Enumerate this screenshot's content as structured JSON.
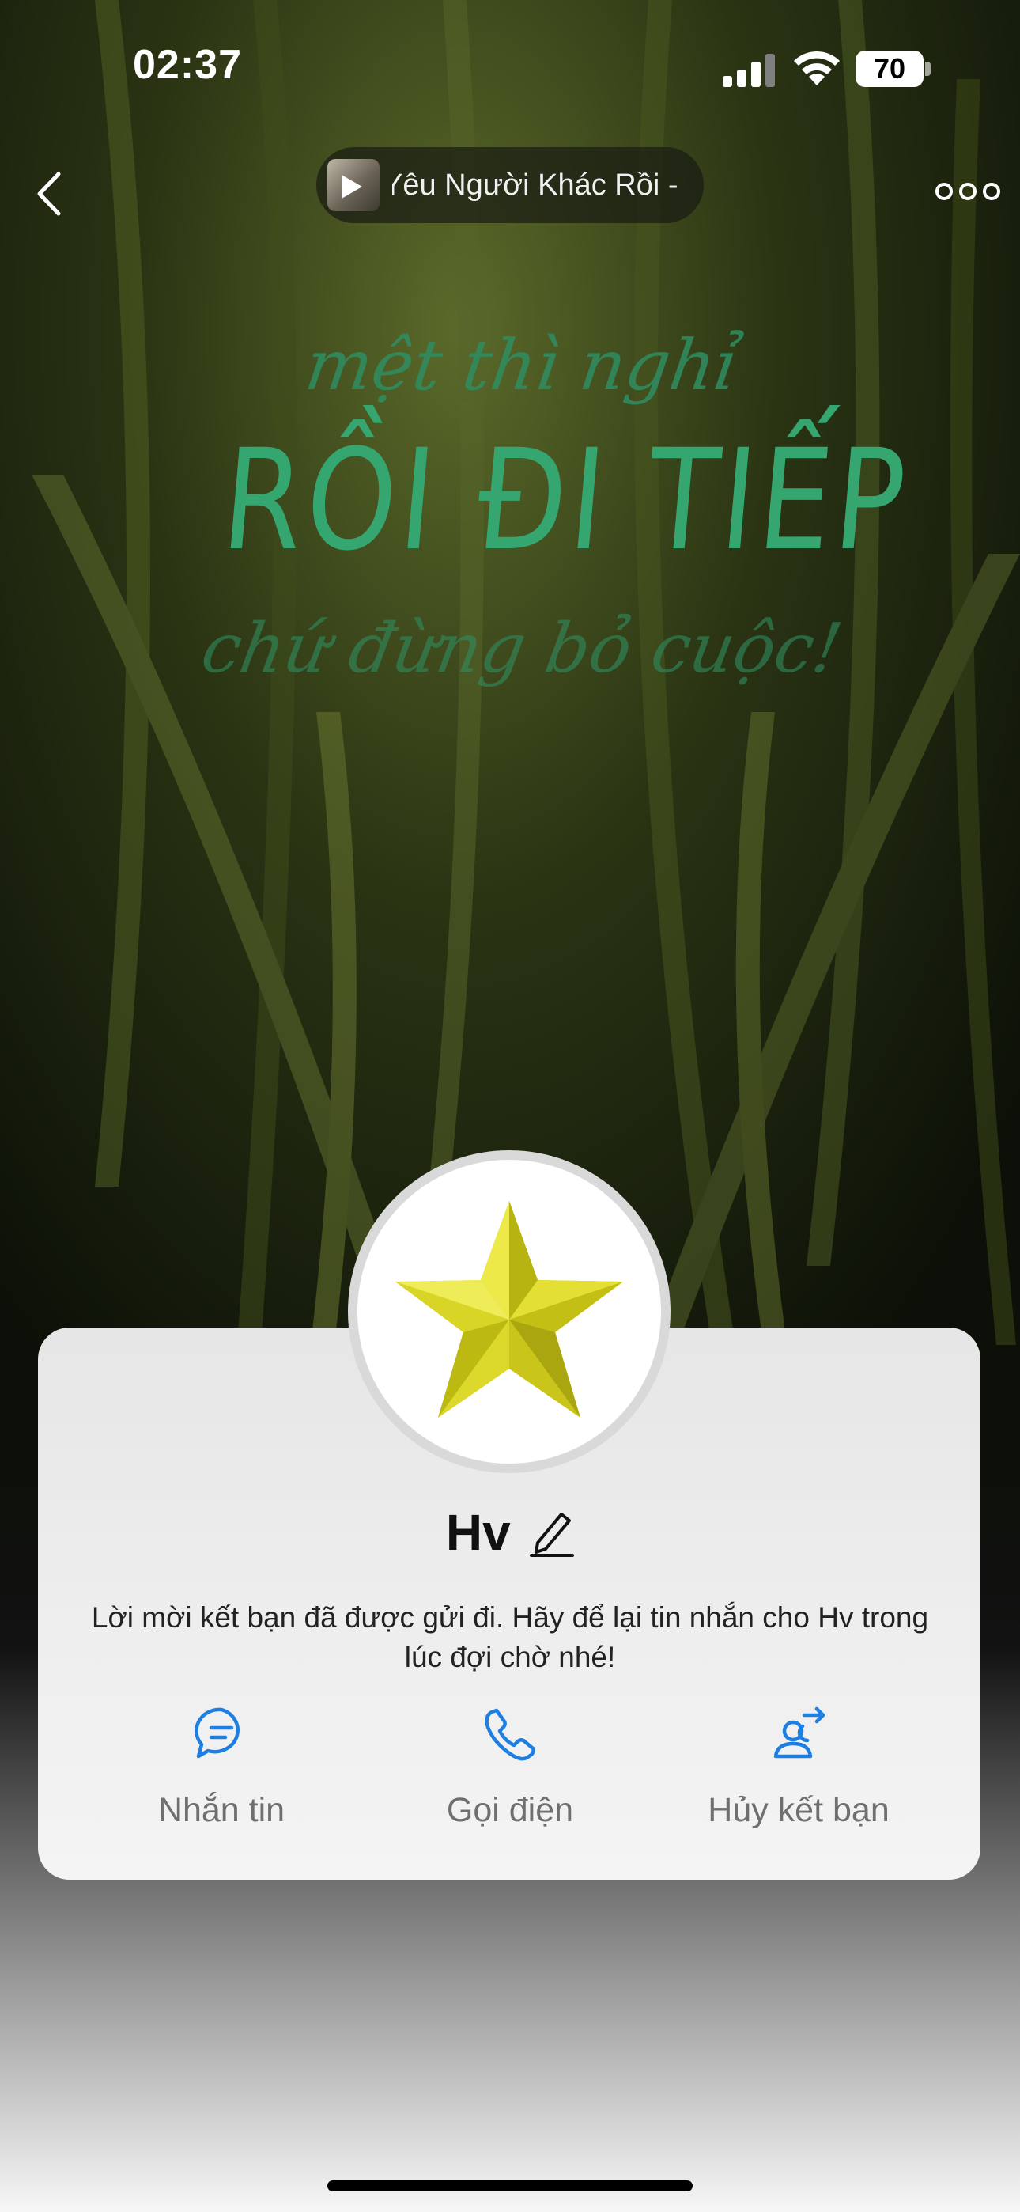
{
  "status_bar": {
    "time": "02:37",
    "battery": "70",
    "battery_level": 0.7
  },
  "header": {
    "music": {
      "title": "Yêu Người Khác Rồi -",
      "state_icon": "play-icon"
    },
    "back_icon": "chevron-left-icon",
    "more_icon": "more-horizontal-icon"
  },
  "cover": {
    "line1": "mệt thì nghỉ",
    "line2": "RỒI ĐI TIẾP",
    "line3": "chứ đừng bỏ cuộc!"
  },
  "profile": {
    "avatar_icon": "star-avatar",
    "name": "Hv",
    "edit_icon": "pencil-icon",
    "message": "Lời mời kết bạn đã được gửi đi. Hãy để lại tin nhắn cho Hv trong lúc đợi chờ nhé!"
  },
  "actions": [
    {
      "label": "Nhắn tin",
      "icon": "chat-bubble-icon"
    },
    {
      "label": "Gọi điện",
      "icon": "phone-icon"
    },
    {
      "label": "Hủy kết bạn",
      "icon": "cancel-friend-icon"
    }
  ],
  "colors": {
    "accent": "#1f7fe0",
    "cover_text": "#36a670"
  }
}
